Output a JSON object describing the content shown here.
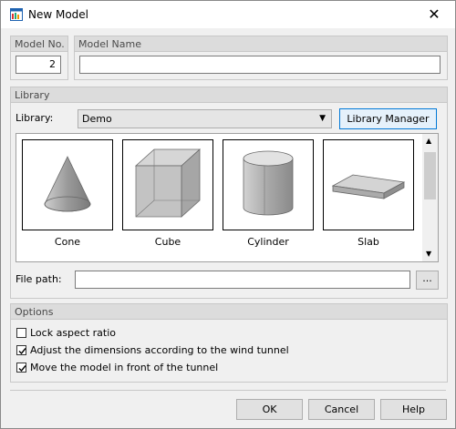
{
  "window": {
    "title": "New Model",
    "close_glyph": "✕"
  },
  "model_no": {
    "label": "Model No.",
    "value": "2"
  },
  "model_name": {
    "label": "Model Name",
    "value": ""
  },
  "library": {
    "group_label": "Library",
    "field_label": "Library:",
    "selected": "Demo",
    "manager_button": "Library Manager",
    "items": [
      "Cone",
      "Cube",
      "Cylinder",
      "Slab"
    ]
  },
  "file_path": {
    "label": "File path:",
    "value": "",
    "browse_button": "..."
  },
  "options": {
    "group_label": "Options",
    "checkboxes": [
      {
        "label": "Lock aspect ratio",
        "checked": false
      },
      {
        "label": "Adjust the dimensions according to the wind tunnel",
        "checked": true
      },
      {
        "label": "Move the model in front of the tunnel",
        "checked": true
      }
    ]
  },
  "buttons": {
    "ok": "OK",
    "cancel": "Cancel",
    "help": "Help"
  }
}
